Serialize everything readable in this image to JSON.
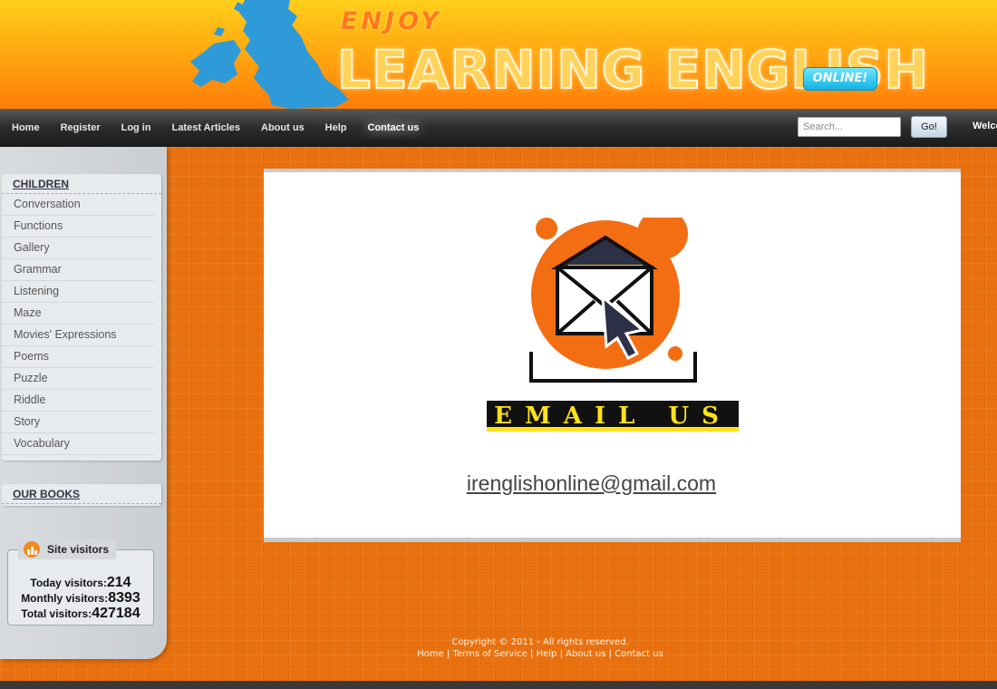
{
  "header": {
    "enjoy": "ENJOY",
    "brand": "LEARNING ENGLISH",
    "badge": "ONLINE!"
  },
  "nav": {
    "links": [
      "Home",
      "Register",
      "Log in",
      "Latest Articles",
      "About us",
      "Help",
      "Contact us"
    ],
    "active": "Contact us",
    "search_placeholder": "Search...",
    "go_label": "Go!",
    "welcome": "Welco"
  },
  "sidebar": {
    "children_title": "CHILDREN",
    "children_items": [
      "Conversation",
      "Functions",
      "Gallery",
      "Grammar",
      "Listening",
      "Maze",
      "Movies' Expressions",
      "Poems",
      "Puzzle",
      "Riddle",
      "Story",
      "Vocabulary"
    ],
    "books_title": "OUR BOOKS",
    "visitors": {
      "title": "Site visitors",
      "today_label": "Today visitors:",
      "today": "214",
      "monthly_label": "Monthly visitors:",
      "monthly": "8393",
      "total_label": "Total visitors:",
      "total": "427184"
    }
  },
  "main": {
    "banner": "EMAIL US",
    "email": "irenglishonline@gmail.com"
  },
  "footer": {
    "copyright": "Copyright © 2011 - All rights reserved.",
    "links": [
      "Home",
      "Terms of Service",
      "Help",
      "About us",
      "Contact us"
    ]
  },
  "colors": {
    "page_orange": "#e8700e",
    "nav_dark": "#1a1a1a",
    "banner_yellow": "#ffe21a",
    "badge_blue": "#13b3e2"
  }
}
